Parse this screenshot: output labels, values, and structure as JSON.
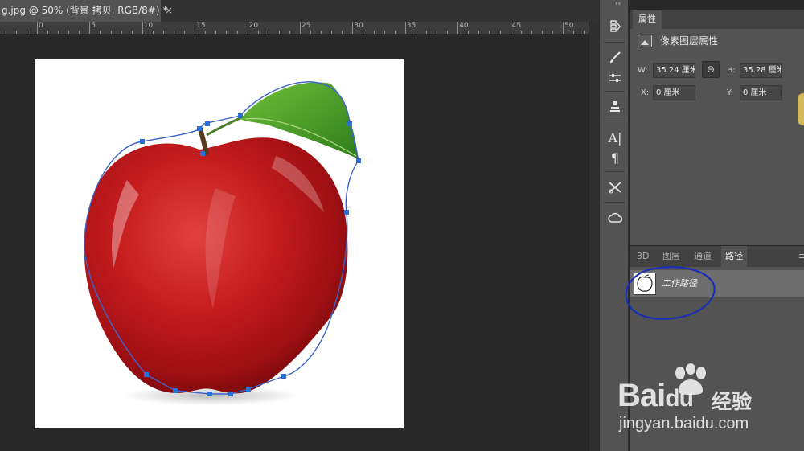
{
  "document": {
    "tab_title": "g.jpg @ 50% (背景 拷贝, RGB/8#) *",
    "close_glyph": "×"
  },
  "ruler": {
    "labels": [
      "0",
      "5",
      "10",
      "15",
      "20",
      "25",
      "30",
      "35",
      "40",
      "45",
      "50"
    ]
  },
  "tool_strip": {
    "collapse_glyph": "‹‹",
    "tools": [
      "history-icon",
      "brush-icon",
      "brush-settings-icon",
      "clone-source-icon",
      "character-icon",
      "paragraph-icon",
      "tool-presets-icon",
      "libraries-icon"
    ]
  },
  "properties": {
    "tab_label": "属性",
    "header_label": "像素图层属性",
    "w_label": "W:",
    "w_value": "35.24 厘米",
    "h_label": "H:",
    "h_value": "35.28 厘米",
    "x_label": "X:",
    "x_value": "0 厘米",
    "y_label": "Y:",
    "y_value": "0 厘米",
    "link_glyph": "⊖"
  },
  "paths_panel": {
    "tabs": [
      "3D",
      "图层",
      "通道",
      "路径"
    ],
    "active_tab": "路径",
    "menu_glyph": "≡",
    "items": [
      {
        "name": "工作路径"
      }
    ]
  },
  "watermark": {
    "brand": "Bai",
    "brand_tail": "du",
    "cn": "经验",
    "url": "jingyan.baidu.com"
  },
  "colors": {
    "annotation": "#1a2fb4",
    "path_stroke": "#3b63c9",
    "anchor": "#2a6fd6"
  }
}
